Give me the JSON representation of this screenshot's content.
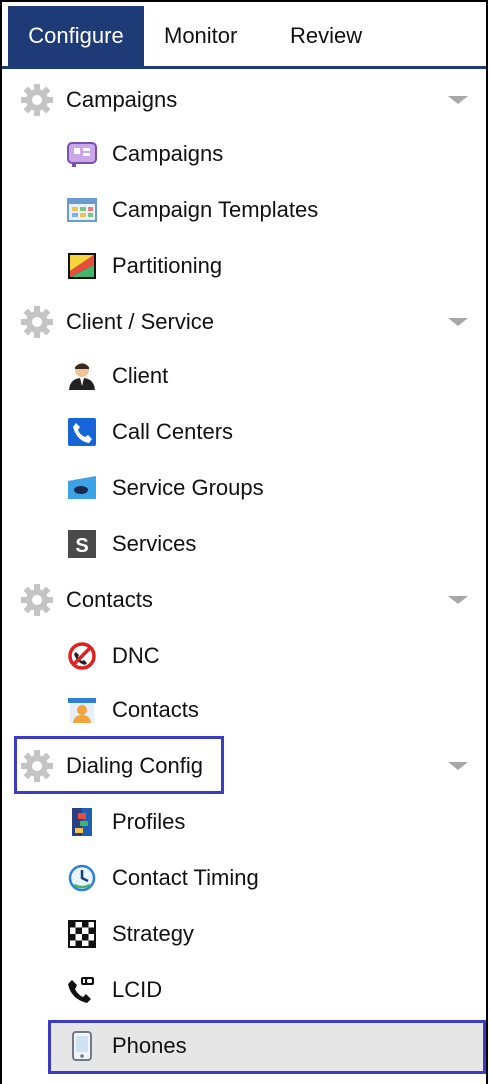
{
  "tabs": [
    {
      "label": "Configure",
      "active": true
    },
    {
      "label": "Monitor",
      "active": false
    },
    {
      "label": "Review",
      "active": false
    }
  ],
  "colors": {
    "accent": "#1e3a77",
    "highlight": "#3b3cc4",
    "selected": "#e6e6e6"
  },
  "sections": [
    {
      "label": "Campaigns",
      "icon": "gear-icon",
      "items": [
        {
          "label": "Campaigns",
          "icon": "campaigns-icon"
        },
        {
          "label": "Campaign Templates",
          "icon": "campaign-templates-icon"
        },
        {
          "label": "Partitioning",
          "icon": "partitioning-icon"
        }
      ]
    },
    {
      "label": "Client / Service",
      "icon": "gear-icon",
      "items": [
        {
          "label": "Client",
          "icon": "client-icon"
        },
        {
          "label": "Call Centers",
          "icon": "call-centers-icon"
        },
        {
          "label": "Service Groups",
          "icon": "service-groups-icon"
        },
        {
          "label": "Services",
          "icon": "services-icon"
        }
      ]
    },
    {
      "label": "Contacts",
      "icon": "gear-icon",
      "items": [
        {
          "label": "DNC",
          "icon": "dnc-icon"
        },
        {
          "label": "Contacts",
          "icon": "contacts-icon"
        }
      ]
    },
    {
      "label": "Dialing Config",
      "icon": "gear-icon",
      "highlighted": true,
      "items": [
        {
          "label": "Profiles",
          "icon": "profiles-icon"
        },
        {
          "label": "Contact Timing",
          "icon": "contact-timing-icon"
        },
        {
          "label": "Strategy",
          "icon": "strategy-icon"
        },
        {
          "label": "LCID",
          "icon": "lcid-icon"
        },
        {
          "label": "Phones",
          "icon": "phones-icon",
          "selected": true
        }
      ]
    }
  ],
  "services_icon_glyph": "S"
}
